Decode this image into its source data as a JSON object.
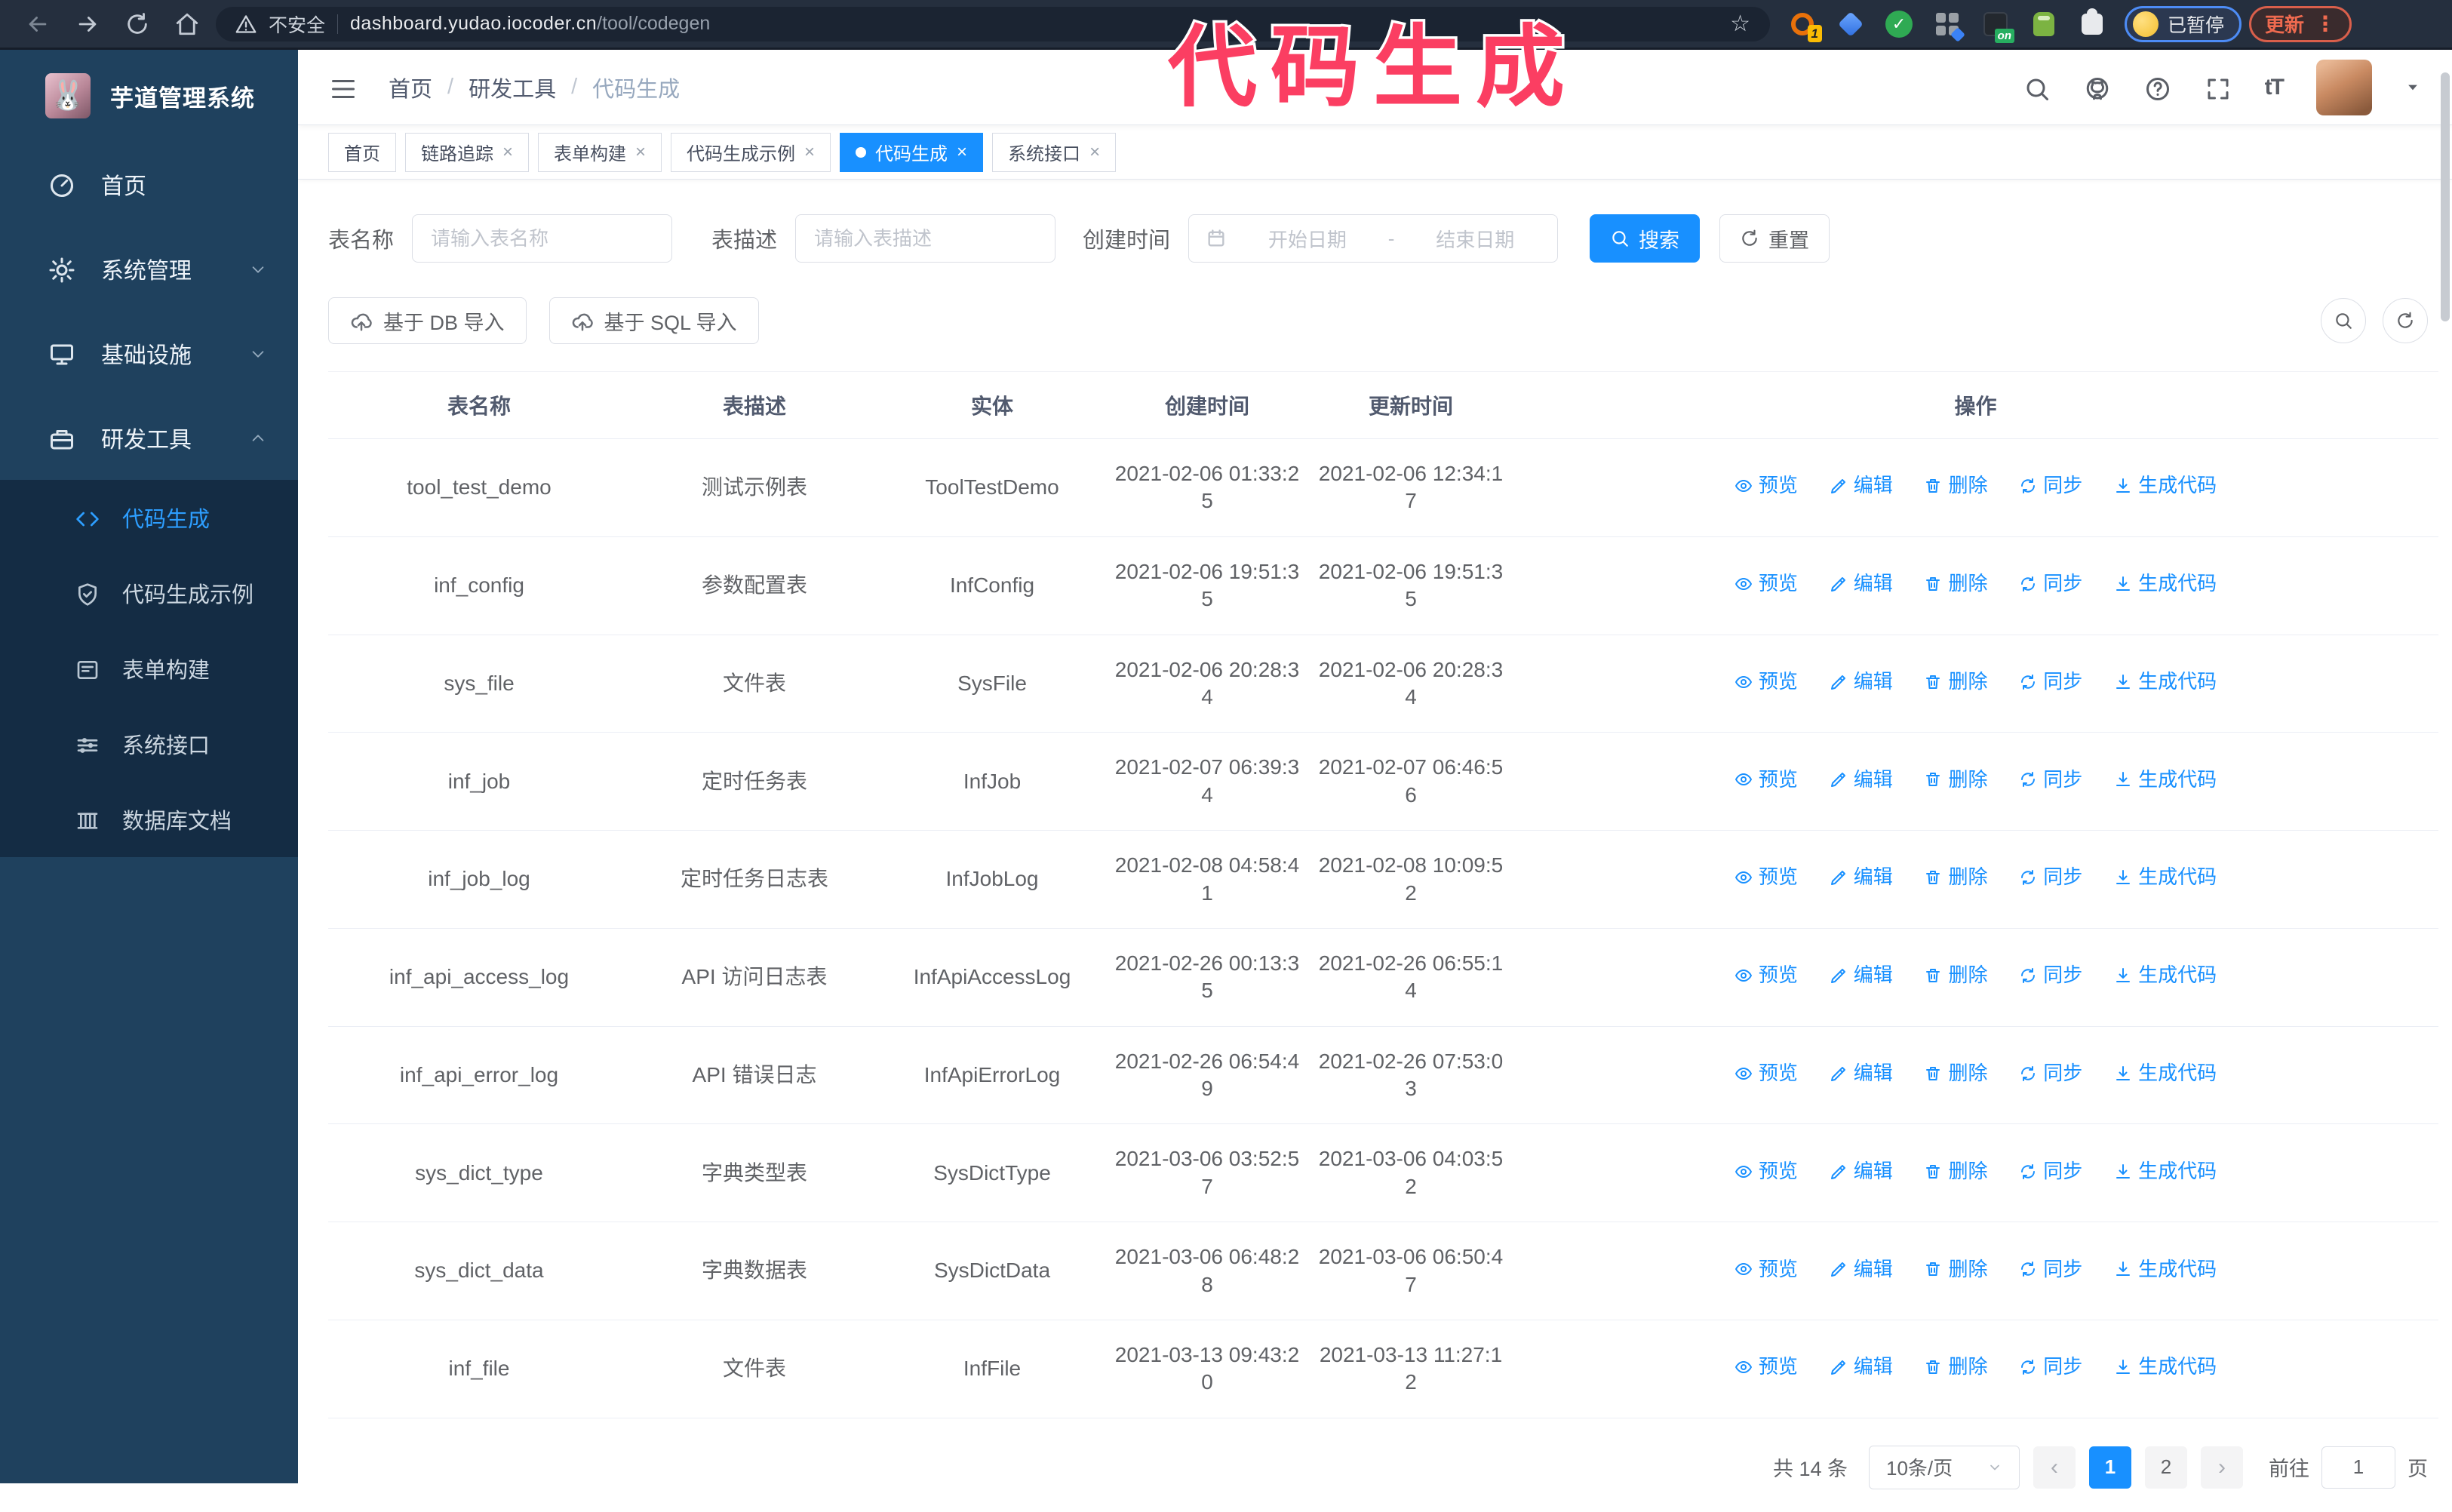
{
  "browser": {
    "security_label": "不安全",
    "url_host": "dashboard.yudao.iocoder.cn",
    "url_path": "/tool/codegen",
    "extension_badge": "1",
    "extension_on_badge": "on",
    "profile_chip_label": "已暂停",
    "update_button_label": "更新"
  },
  "overlay": {
    "annotation": "代码生成",
    "color": "#fb3e62"
  },
  "sidebar": {
    "logo_title": "芋道管理系统",
    "items": [
      {
        "label": "首页",
        "icon": "dashboard-icon"
      },
      {
        "label": "系统管理",
        "icon": "gear-icon",
        "state": "collapsed"
      },
      {
        "label": "基础设施",
        "icon": "monitor-icon",
        "state": "collapsed"
      },
      {
        "label": "研发工具",
        "icon": "toolbox-icon",
        "state": "expanded"
      }
    ],
    "submenu": [
      {
        "label": "代码生成",
        "icon": "code-icon",
        "active": true
      },
      {
        "label": "代码生成示例",
        "icon": "shield-check-icon"
      },
      {
        "label": "表单构建",
        "icon": "form-icon"
      },
      {
        "label": "系统接口",
        "icon": "sliders-icon"
      },
      {
        "label": "数据库文档",
        "icon": "database-icon"
      }
    ]
  },
  "header": {
    "breadcrumb": [
      "首页",
      "研发工具",
      "代码生成"
    ]
  },
  "tabs": [
    {
      "label": "首页",
      "closable": false,
      "active": false
    },
    {
      "label": "链路追踪",
      "closable": true,
      "active": false
    },
    {
      "label": "表单构建",
      "closable": true,
      "active": false
    },
    {
      "label": "代码生成示例",
      "closable": true,
      "active": false
    },
    {
      "label": "代码生成",
      "closable": true,
      "active": true
    },
    {
      "label": "系统接口",
      "closable": true,
      "active": false
    }
  ],
  "filters": {
    "name_label": "表名称",
    "name_placeholder": "请输入表名称",
    "desc_label": "表描述",
    "desc_placeholder": "请输入表描述",
    "time_label": "创建时间",
    "start_placeholder": "开始日期",
    "range_separator": "-",
    "end_placeholder": "结束日期",
    "search_label": "搜索",
    "reset_label": "重置"
  },
  "toolbar": {
    "import_db_label": "基于 DB 导入",
    "import_sql_label": "基于 SQL 导入"
  },
  "table": {
    "columns": [
      "表名称",
      "表描述",
      "实体",
      "创建时间",
      "更新时间",
      "操作"
    ],
    "actions": [
      "预览",
      "编辑",
      "删除",
      "同步",
      "生成代码"
    ],
    "rows": [
      {
        "name": "tool_test_demo",
        "desc": "测试示例表",
        "entity": "ToolTestDemo",
        "created": "2021-02-06 01:33:25",
        "updated": "2021-02-06 12:34:17"
      },
      {
        "name": "inf_config",
        "desc": "参数配置表",
        "entity": "InfConfig",
        "created": "2021-02-06 19:51:35",
        "updated": "2021-02-06 19:51:35"
      },
      {
        "name": "sys_file",
        "desc": "文件表",
        "entity": "SysFile",
        "created": "2021-02-06 20:28:34",
        "updated": "2021-02-06 20:28:34"
      },
      {
        "name": "inf_job",
        "desc": "定时任务表",
        "entity": "InfJob",
        "created": "2021-02-07 06:39:34",
        "updated": "2021-02-07 06:46:56"
      },
      {
        "name": "inf_job_log",
        "desc": "定时任务日志表",
        "entity": "InfJobLog",
        "created": "2021-02-08 04:58:41",
        "updated": "2021-02-08 10:09:52"
      },
      {
        "name": "inf_api_access_log",
        "desc": "API 访问日志表",
        "entity": "InfApiAccessLog",
        "created": "2021-02-26 00:13:35",
        "updated": "2021-02-26 06:55:14"
      },
      {
        "name": "inf_api_error_log",
        "desc": "API 错误日志",
        "entity": "InfApiErrorLog",
        "created": "2021-02-26 06:54:49",
        "updated": "2021-02-26 07:53:03"
      },
      {
        "name": "sys_dict_type",
        "desc": "字典类型表",
        "entity": "SysDictType",
        "created": "2021-03-06 03:52:57",
        "updated": "2021-03-06 04:03:52"
      },
      {
        "name": "sys_dict_data",
        "desc": "字典数据表",
        "entity": "SysDictData",
        "created": "2021-03-06 06:48:28",
        "updated": "2021-03-06 06:50:47"
      },
      {
        "name": "inf_file",
        "desc": "文件表",
        "entity": "InfFile",
        "created": "2021-03-13 09:43:20",
        "updated": "2021-03-13 11:27:12"
      }
    ]
  },
  "pagination": {
    "total_label": "共 14 条",
    "page_size_label": "10条/页",
    "pages": [
      "1",
      "2"
    ],
    "active_page": "1",
    "jump_prefix": "前往",
    "jump_value": "1",
    "jump_suffix": "页"
  },
  "colors": {
    "primary": "#1890ff",
    "sidebar_bg": "#1f415e",
    "submenu_bg": "#142c44",
    "annotation": "#fb3e62"
  }
}
